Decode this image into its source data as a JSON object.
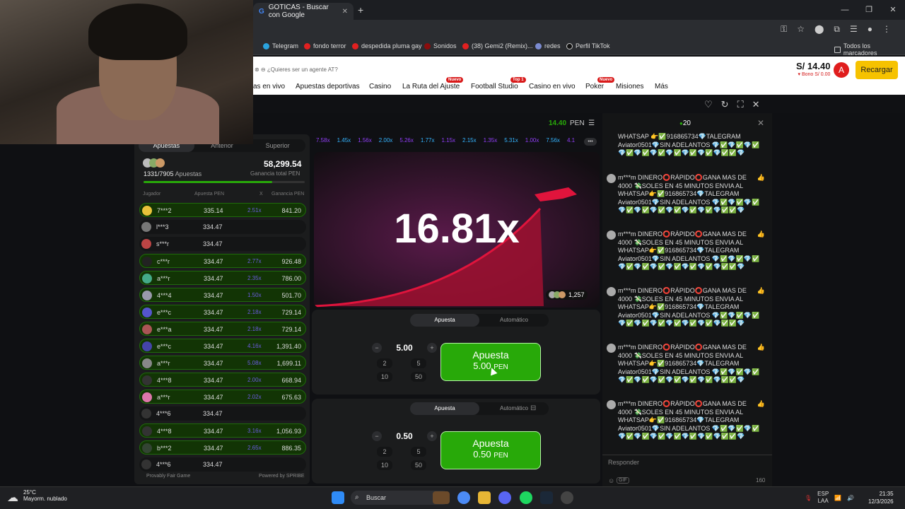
{
  "browser": {
    "tab_title": "GOTICAS - Buscar con Google",
    "bookmarks": [
      "Telegram",
      "fondo terror",
      "despedida pluma gay",
      "Sonidos",
      "(38) Gemi2 (Remix)...",
      "redes",
      "Perfil TikTok"
    ],
    "all_bookmarks": "Todos los marcadores"
  },
  "site": {
    "agent_text": "¿Quieres ser un agente AT?",
    "nav": [
      "as en vivo",
      "Apuestas deportivas",
      "Casino",
      "La Ruta del Ajuste",
      "Football Studio",
      "Casino en vivo",
      "Poker",
      "Misiones",
      "Más"
    ],
    "badges": {
      "ruta": "Nuevo",
      "football": "Top 1",
      "poker": "Nuevo"
    },
    "balance": "S/ 14.40",
    "bonus": "Bono S/ 0.00",
    "avatar_letter": "A",
    "recharge": "Recargar"
  },
  "game": {
    "balance": "14.40",
    "currency": "PEN",
    "multiplier": "16.81x",
    "players_online": "1,257",
    "history": [
      "7.58x",
      "1.45x",
      "1.56x",
      "2.00x",
      "5.26x",
      "1.77x",
      "1.15x",
      "2.15x",
      "1.35x",
      "5.31x",
      "1.00x",
      "7.56x",
      "4.1"
    ]
  },
  "left": {
    "tabs": [
      "Apuestas",
      "Anterior",
      "Superior"
    ],
    "bets_count": "1331/7905",
    "bets_label": "Apuestas",
    "total": "58,299.54",
    "total_label": "Ganancia total PEN",
    "progress": 0.8,
    "headers": {
      "player": "Jugador",
      "bet": "Apuesta PEN",
      "x": "X",
      "win": "Ganancia PEN"
    },
    "rows": [
      {
        "name": "7***2",
        "bet": "335.14",
        "x": "2.51x",
        "win": "841.20"
      },
      {
        "name": "l***3",
        "bet": "334.47",
        "x": "",
        "win": ""
      },
      {
        "name": "s***r",
        "bet": "334.47",
        "x": "",
        "win": ""
      },
      {
        "name": "c***r",
        "bet": "334.47",
        "x": "2.77x",
        "win": "926.48"
      },
      {
        "name": "a***r",
        "bet": "334.47",
        "x": "2.35x",
        "win": "786.00"
      },
      {
        "name": "4***4",
        "bet": "334.47",
        "x": "1.50x",
        "win": "501.70"
      },
      {
        "name": "e***c",
        "bet": "334.47",
        "x": "2.18x",
        "win": "729.14"
      },
      {
        "name": "e***a",
        "bet": "334.47",
        "x": "2.18x",
        "win": "729.14"
      },
      {
        "name": "e***c",
        "bet": "334.47",
        "x": "4.16x",
        "win": "1,391.40"
      },
      {
        "name": "a***r",
        "bet": "334.47",
        "x": "5.08x",
        "win": "1,699.11"
      },
      {
        "name": "4***8",
        "bet": "334.47",
        "x": "2.00x",
        "win": "668.94"
      },
      {
        "name": "a***r",
        "bet": "334.47",
        "x": "2.02x",
        "win": "675.63"
      },
      {
        "name": "4***6",
        "bet": "334.47",
        "x": "",
        "win": ""
      },
      {
        "name": "4***8",
        "bet": "334.47",
        "x": "3.16x",
        "win": "1,056.93"
      },
      {
        "name": "b***2",
        "bet": "334.47",
        "x": "2.65x",
        "win": "886.35"
      },
      {
        "name": "4***6",
        "bet": "334.47",
        "x": "",
        "win": ""
      }
    ],
    "fair": "Provably Fair Game",
    "powered": "Powered by SPRIBE"
  },
  "bet1": {
    "tab_bet": "Apuesta",
    "tab_auto": "Automático",
    "value": "5.00",
    "q": [
      "2",
      "5",
      "10",
      "50"
    ],
    "btn": "Apuesta",
    "btn_amt": "5.00",
    "btn_cur": "PEN"
  },
  "bet2": {
    "tab_bet": "Apuesta",
    "tab_auto": "Automático",
    "value": "0.50",
    "q": [
      "2",
      "5",
      "10",
      "50"
    ],
    "btn": "Apuesta",
    "btn_amt": "0.50",
    "btn_cur": "PEN"
  },
  "chat": {
    "online": "20",
    "first": "WHATSAP 👉✅916865734💎TALEGRAM Aviator0501💎SIN ADELANTOS 💎✅💎✅💎✅💎✅💎✅💎✅💎✅💎✅💎✅💎✅✅💎",
    "msg": "m***m DINERO⭕RÁPIDO⭕GANA MAS DE 4000 💸SOLES EN 45 MINUTOS ENVIA AL WHATSAP👉✅916865734💎TALEGRAM Aviator0501💎SIN ADELANTOS 💎✅💎✅💎✅💎✅💎✅💎✅💎✅💎✅💎✅💎✅✅💎",
    "respond": "Responder",
    "count": "160",
    "gif": "GIF"
  },
  "taskbar": {
    "temp": "25°C",
    "weather": "Mayorm. nublado",
    "search": "Buscar",
    "lang1": "ESP",
    "lang2": "LAA",
    "time": "21:35",
    "date": "12/3/2026"
  },
  "colors": {
    "green": "#28a909",
    "red": "#d91a1a",
    "yellow": "#f6c200",
    "purple": "#913ef8",
    "blue": "#34b4ff"
  }
}
